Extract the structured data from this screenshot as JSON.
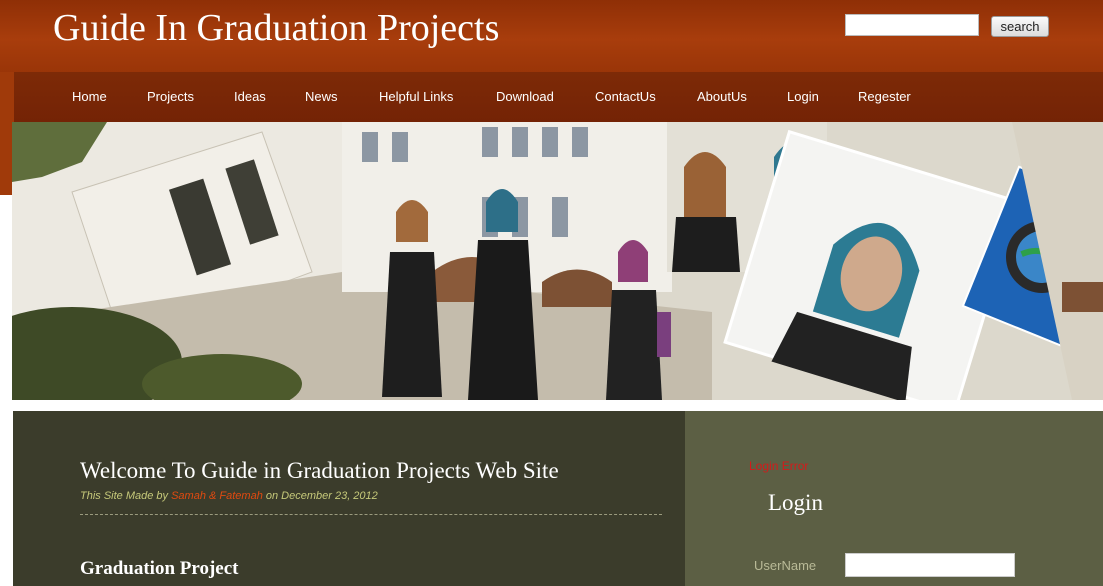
{
  "header": {
    "site_title": "Guide In Graduation Projects",
    "search_placeholder": "",
    "search_button": "search"
  },
  "nav": {
    "items": [
      {
        "label": "Home"
      },
      {
        "label": "Projects"
      },
      {
        "label": "Ideas"
      },
      {
        "label": "News"
      },
      {
        "label": "Helpful Links"
      },
      {
        "label": "Download"
      },
      {
        "label": "ContactUs"
      },
      {
        "label": "AboutUs"
      },
      {
        "label": "Login"
      },
      {
        "label": "Regester"
      }
    ]
  },
  "content": {
    "welcome_title": "Welcome To Guide in Graduation Projects Web Site",
    "byline_prefix": "This Site Made by ",
    "byline_author": "Samah & Fatemah",
    "byline_suffix": " on December 23, 2012",
    "section_title": "Graduation Project"
  },
  "sidebar": {
    "login_error": "Login Error",
    "login_heading": "Login",
    "username_label": "UserName",
    "username_value": ""
  },
  "colors": {
    "header": "#a03a0a",
    "nav": "#7a2806",
    "content_bg": "#3b3c2b",
    "sidebar_bg": "#5c5f44",
    "author_accent": "#e04a10",
    "error": "#d41a1a"
  }
}
